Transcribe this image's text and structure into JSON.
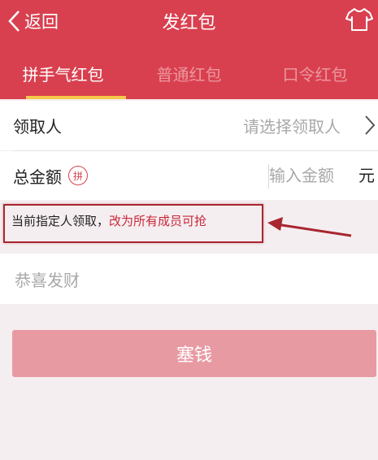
{
  "header": {
    "back_label": "返回",
    "title": "发红包",
    "skin_icon": "tshirt-icon",
    "bg_color": "#d9404f"
  },
  "tabs": [
    {
      "label": "拼手气红包",
      "active": true
    },
    {
      "label": "普通红包",
      "active": false
    },
    {
      "label": "口令红包",
      "active": false
    }
  ],
  "recipient": {
    "label": "领取人",
    "placeholder": "请选择领取人"
  },
  "amount": {
    "label": "总金额",
    "badge": "拼",
    "placeholder": "输入金额",
    "unit": "元"
  },
  "hint": {
    "text": "当前指定人领取，",
    "link": "改为所有成员可抢"
  },
  "greeting": {
    "placeholder": "恭喜发财"
  },
  "submit": {
    "label": "塞钱",
    "color": "#e89aa3"
  }
}
